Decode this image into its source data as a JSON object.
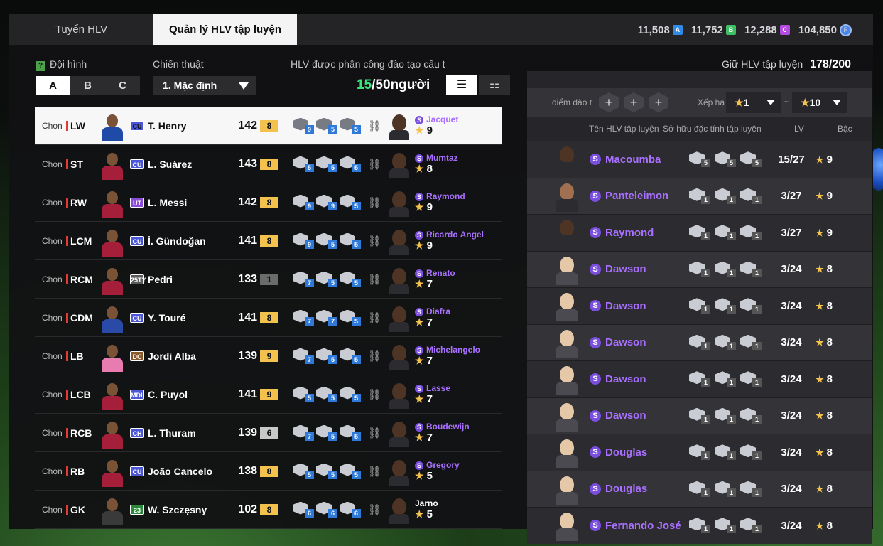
{
  "tabs": [
    "Tuyển HLV",
    "Quản lý HLV tập luyện"
  ],
  "currency": [
    {
      "value": "11,508",
      "badge": "A",
      "color": "#2f8be6"
    },
    {
      "value": "11,752",
      "badge": "B",
      "color": "#3fbf63"
    },
    {
      "value": "12,288",
      "badge": "C",
      "color": "#b54be0"
    },
    {
      "value": "104,850",
      "badge": "coin-icon",
      "color": "#4a86e8"
    }
  ],
  "left": {
    "squad_label": "Đội hình",
    "help": "?",
    "squad_options": [
      "A",
      "B",
      "C"
    ],
    "tactic_label": "Chiến thuật",
    "tactic_value": "1. Mặc định",
    "assigned_label": "HLV được phân công đào tạo cầu t",
    "assigned_count": "15",
    "assigned_total": "/50người",
    "select_label": "Chọn"
  },
  "players": [
    {
      "pos": "LW",
      "season": "CU",
      "season_color": "#4b57d6",
      "name": "T. Henry",
      "ovr": "142",
      "grade": "8",
      "grade_color": "#f2c14e",
      "kit": "#1f4aa8",
      "traits": [
        "9",
        "5",
        "5"
      ],
      "coach": "Jacquet",
      "stars": "9",
      "selected": true
    },
    {
      "pos": "ST",
      "season": "CU",
      "season_color": "#4b57d6",
      "name": "L. Suárez",
      "ovr": "143",
      "grade": "8",
      "grade_color": "#f2c14e",
      "kit": "#a51f3a",
      "traits": [
        "5",
        "5",
        "5"
      ],
      "coach": "Mumtaz",
      "stars": "8"
    },
    {
      "pos": "RW",
      "season": "UT",
      "season_color": "#8a4bd6",
      "name": "L. Messi",
      "ovr": "142",
      "grade": "8",
      "grade_color": "#f2c14e",
      "kit": "#a51f3a",
      "traits": [
        "9",
        "9",
        "5"
      ],
      "coach": "Raymond",
      "stars": "9"
    },
    {
      "pos": "LCM",
      "season": "CU",
      "season_color": "#4b57d6",
      "name": "İ. Gündoğan",
      "ovr": "141",
      "grade": "8",
      "grade_color": "#f2c14e",
      "kit": "#a51f3a",
      "traits": [
        "9",
        "5",
        "5"
      ],
      "coach": "Ricardo Angel",
      "stars": "9"
    },
    {
      "pos": "RCM",
      "season": "25TY",
      "season_color": "#5a5a5a",
      "name": "Pedri",
      "ovr": "133",
      "grade": "1",
      "grade_color": "#6b6b6b",
      "kit": "#a51f3a",
      "traits": [
        "7",
        "5",
        "5"
      ],
      "coach": "Renato",
      "stars": "7"
    },
    {
      "pos": "CDM",
      "season": "CU",
      "season_color": "#4b57d6",
      "name": "Y. Touré",
      "ovr": "141",
      "grade": "8",
      "grade_color": "#f2c14e",
      "kit": "#2a4aa8",
      "traits": [
        "7",
        "7",
        "5"
      ],
      "coach": "Diafra",
      "stars": "7"
    },
    {
      "pos": "LB",
      "season": "DC",
      "season_color": "#8a5a2a",
      "name": "Jordi Alba",
      "ovr": "139",
      "grade": "9",
      "grade_color": "#f2c14e",
      "kit": "#e87cb0",
      "traits": [
        "7",
        "5",
        "5"
      ],
      "coach": "Michelangelo",
      "stars": "7"
    },
    {
      "pos": "LCB",
      "season": "MDL",
      "season_color": "#4b57d6",
      "name": "C. Puyol",
      "ovr": "141",
      "grade": "9",
      "grade_color": "#f2c14e",
      "kit": "#a51f3a",
      "traits": [
        "5",
        "5",
        "5"
      ],
      "coach": "Lasse",
      "stars": "7"
    },
    {
      "pos": "RCB",
      "season": "CH",
      "season_color": "#4b57d6",
      "name": "L. Thuram",
      "ovr": "139",
      "grade": "6",
      "grade_color": "#c8c8c8",
      "kit": "#a51f3a",
      "traits": [
        "7",
        "5",
        "5"
      ],
      "coach": "Boudewijn",
      "stars": "7"
    },
    {
      "pos": "RB",
      "season": "CU",
      "season_color": "#4b57d6",
      "name": "João Cancelo",
      "ovr": "138",
      "grade": "8",
      "grade_color": "#f2c14e",
      "kit": "#a51f3a",
      "traits": [
        "5",
        "5",
        "5"
      ],
      "coach": "Gregory",
      "stars": "5"
    },
    {
      "pos": "GK",
      "season": "23",
      "season_color": "#2a8a3a",
      "name": "W. Szczęsny",
      "ovr": "102",
      "grade": "8",
      "grade_color": "#f2c14e",
      "kit": "#3a3a3a",
      "traits": [
        "6",
        "6",
        "6"
      ],
      "coach": "Jarno",
      "stars": "5",
      "plain": true
    }
  ],
  "right": {
    "hold_label": "Giữ HLV tập luyện",
    "hold_value": "178/200",
    "skill_label": "điểm đào t",
    "rank_label": "Xếp hạ",
    "rank_from": "1",
    "tilde": "~",
    "rank_to": "10",
    "plus_sign": "+",
    "cols": [
      "Tên HLV tập luyện",
      "Sở hữu đặc tính tập luyện",
      "LV",
      "Bậc"
    ]
  },
  "coaches": [
    {
      "name": "Macoumba",
      "lv": "15/27",
      "stars": "9",
      "traits": [
        "5",
        "5",
        "5"
      ],
      "skin": "dark"
    },
    {
      "name": "Panteleimon",
      "lv": "3/27",
      "stars": "9",
      "traits": [
        "1",
        "1",
        "1"
      ],
      "skin": "mid"
    },
    {
      "name": "Raymond",
      "lv": "3/27",
      "stars": "9",
      "traits": [
        "1",
        "1",
        "1"
      ],
      "skin": "dark"
    },
    {
      "name": "Dawson",
      "lv": "3/24",
      "stars": "8",
      "traits": [
        "1",
        "1",
        "1"
      ],
      "skin": "light"
    },
    {
      "name": "Dawson",
      "lv": "3/24",
      "stars": "8",
      "traits": [
        "1",
        "1",
        "1"
      ],
      "skin": "light"
    },
    {
      "name": "Dawson",
      "lv": "3/24",
      "stars": "8",
      "traits": [
        "1",
        "1",
        "1"
      ],
      "skin": "light"
    },
    {
      "name": "Dawson",
      "lv": "3/24",
      "stars": "8",
      "traits": [
        "1",
        "1",
        "1"
      ],
      "skin": "light"
    },
    {
      "name": "Dawson",
      "lv": "3/24",
      "stars": "8",
      "traits": [
        "1",
        "1",
        "1"
      ],
      "skin": "light"
    },
    {
      "name": "Douglas",
      "lv": "3/24",
      "stars": "8",
      "traits": [
        "1",
        "1",
        "1"
      ],
      "skin": "light"
    },
    {
      "name": "Douglas",
      "lv": "3/24",
      "stars": "8",
      "traits": [
        "1",
        "1",
        "1"
      ],
      "skin": "light"
    },
    {
      "name": "Fernando José",
      "lv": "3/24",
      "stars": "8",
      "traits": [
        "1",
        "1",
        "1"
      ],
      "skin": "light"
    }
  ],
  "star_glyph": "★",
  "season_badge": "S"
}
